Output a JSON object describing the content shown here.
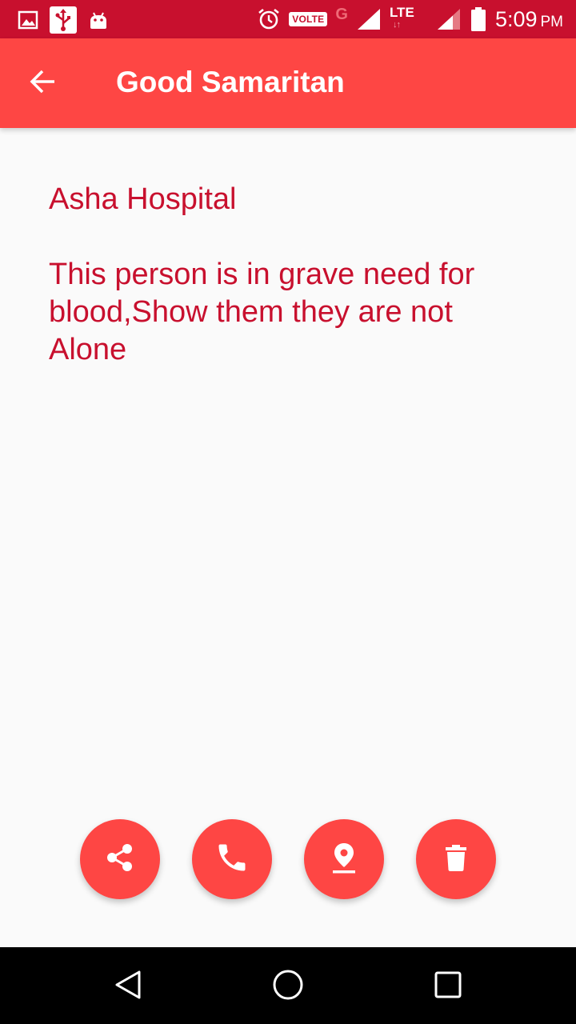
{
  "status_bar": {
    "volte_label": "VOLTE",
    "network_g": "G",
    "lte_label": "LTE",
    "time": "5:09",
    "ampm": "PM",
    "background_color": "#c8102e"
  },
  "app_bar": {
    "title": "Good Samaritan",
    "background_color": "#fe4644"
  },
  "request": {
    "hospital": "Asha Hospital",
    "message": "This person is in grave need for blood,Show them they are not Alone",
    "text_color": "#c8102e"
  },
  "actions": [
    {
      "name": "share",
      "icon": "share-icon"
    },
    {
      "name": "call",
      "icon": "phone-icon"
    },
    {
      "name": "location",
      "icon": "location-pin-icon"
    },
    {
      "name": "delete",
      "icon": "trash-icon"
    }
  ],
  "nav_bar": {
    "buttons": [
      "back-triangle-icon",
      "home-circle-icon",
      "recents-square-icon"
    ]
  }
}
